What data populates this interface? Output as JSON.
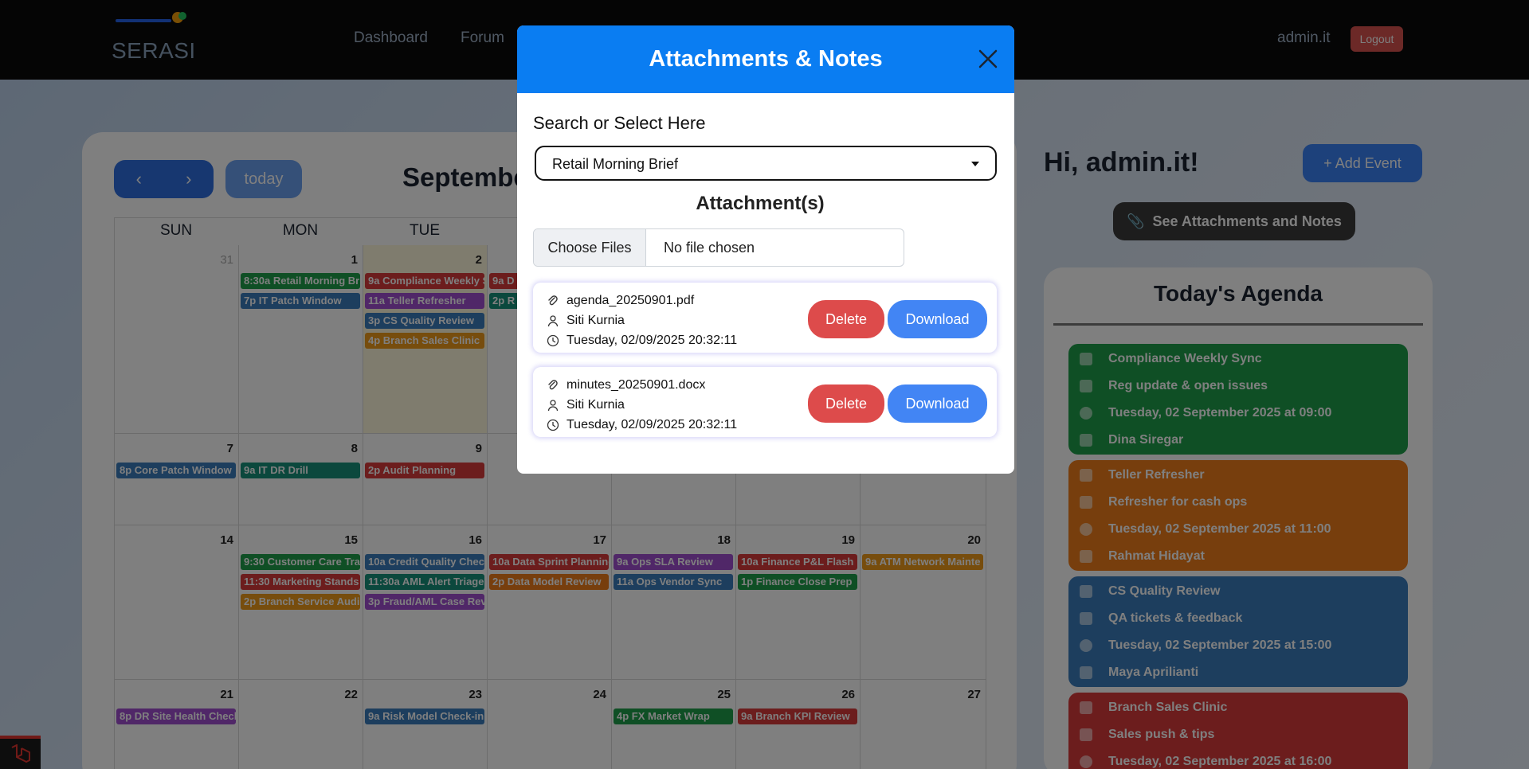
{
  "brand": {
    "name": "SERASI"
  },
  "nav": {
    "links": [
      "Dashboard",
      "Forum"
    ],
    "user": "admin.it",
    "logout": "Logout"
  },
  "calendar": {
    "today_label": "today",
    "title": "Septembe",
    "weekdays": [
      "SUN",
      "MON",
      "TUE"
    ],
    "days": [
      "31",
      "1",
      "2",
      "7",
      "8",
      "9",
      "14",
      "15",
      "16",
      "17",
      "18",
      "19",
      "20",
      "21",
      "22",
      "23",
      "24",
      "25",
      "26",
      "27"
    ],
    "events": {
      "mon1_a": "8:30a Retail Morning Bri",
      "mon1_b": "7p IT Patch Window",
      "tue2_a": "9a Compliance Weekly S",
      "tue2_b": "11a Teller Refresher",
      "tue2_c": "3p CS Quality Review",
      "tue2_d": "4p Branch Sales Clinic",
      "wed3_a": "9a D",
      "wed3_b": "2p R",
      "sun7": "8p Core Patch Window",
      "mon8": "9a IT DR Drill",
      "tue9": "2p Audit Planning",
      "mon15_a": "9:30 Customer Care Trai",
      "mon15_b": "11:30 Marketing Stands",
      "mon15_c": "2p Branch Service Audi",
      "tue16_a": "10a Credit Quality Check",
      "tue16_b": "11:30a AML Alert Triage",
      "tue16_c": "3p Fraud/AML Case Revi",
      "wed17_a": "10a Data Sprint Planning",
      "wed17_b": "2p Data Model Review",
      "thu18_a": "9a Ops SLA Review",
      "thu18_b": "11a Ops Vendor Sync",
      "fri19_a": "10a Finance P&L Flash",
      "fri19_b": "1p Finance Close Prep",
      "sat20": "9a ATM Network Mainte",
      "sun21": "8p DR Site Health Check",
      "tue23": "9a Risk Model Check-in",
      "thu25": "4p FX Market Wrap",
      "fri26": "9a Branch KPI Review"
    }
  },
  "sidebar": {
    "greeting": "Hi, admin.it!",
    "add_event": "+ Add Event",
    "see_attachments": "See Attachments and Notes",
    "agenda_title": "Today's Agenda",
    "agenda": [
      {
        "title": "Compliance Weekly Sync",
        "desc": "Reg update & open issues",
        "time": "Tuesday, 02 September 2025 at 09:00",
        "person": "Dina Siregar",
        "color": "#1e9e4a"
      },
      {
        "title": "Teller Refresher",
        "desc": "Refresher for cash ops",
        "time": "Tuesday, 02 September 2025 at 11:00",
        "person": "Rahmat Hidayat",
        "color": "#ee7d1b"
      },
      {
        "title": "CS Quality Review",
        "desc": "QA tickets & feedback",
        "time": "Tuesday, 02 September 2025 at 15:00",
        "person": "Maya Aprilianti",
        "color": "#3a7dbd"
      },
      {
        "title": "Branch Sales Clinic",
        "desc": "Sales push & tips",
        "time": "Tuesday, 02 September 2025 at 16:00",
        "person": "",
        "color": "#d93a3a"
      }
    ]
  },
  "modal": {
    "title": "Attachments & Notes",
    "search_label": "Search or Select Here",
    "selected_event": "Retail Morning Brief",
    "attachments_heading": "Attachment(s)",
    "choose_files": "Choose Files",
    "no_file": "No file chosen",
    "attachments": [
      {
        "filename": "agenda_20250901.pdf",
        "uploader": "Siti Kurnia",
        "timestamp": "Tuesday, 02/09/2025 20:32:11",
        "delete": "Delete",
        "download": "Download"
      },
      {
        "filename": "minutes_20250901.docx",
        "uploader": "Siti Kurnia",
        "timestamp": "Tuesday, 02/09/2025 20:32:11",
        "delete": "Delete",
        "download": "Download"
      }
    ]
  },
  "icons": {
    "close": "close-icon",
    "caret": "chevron-down-icon",
    "paperclip": "paperclip-icon",
    "user": "user-icon",
    "clock": "clock-icon",
    "calendar": "calendar-icon",
    "note": "note-icon",
    "pin": "person-pin-icon"
  }
}
